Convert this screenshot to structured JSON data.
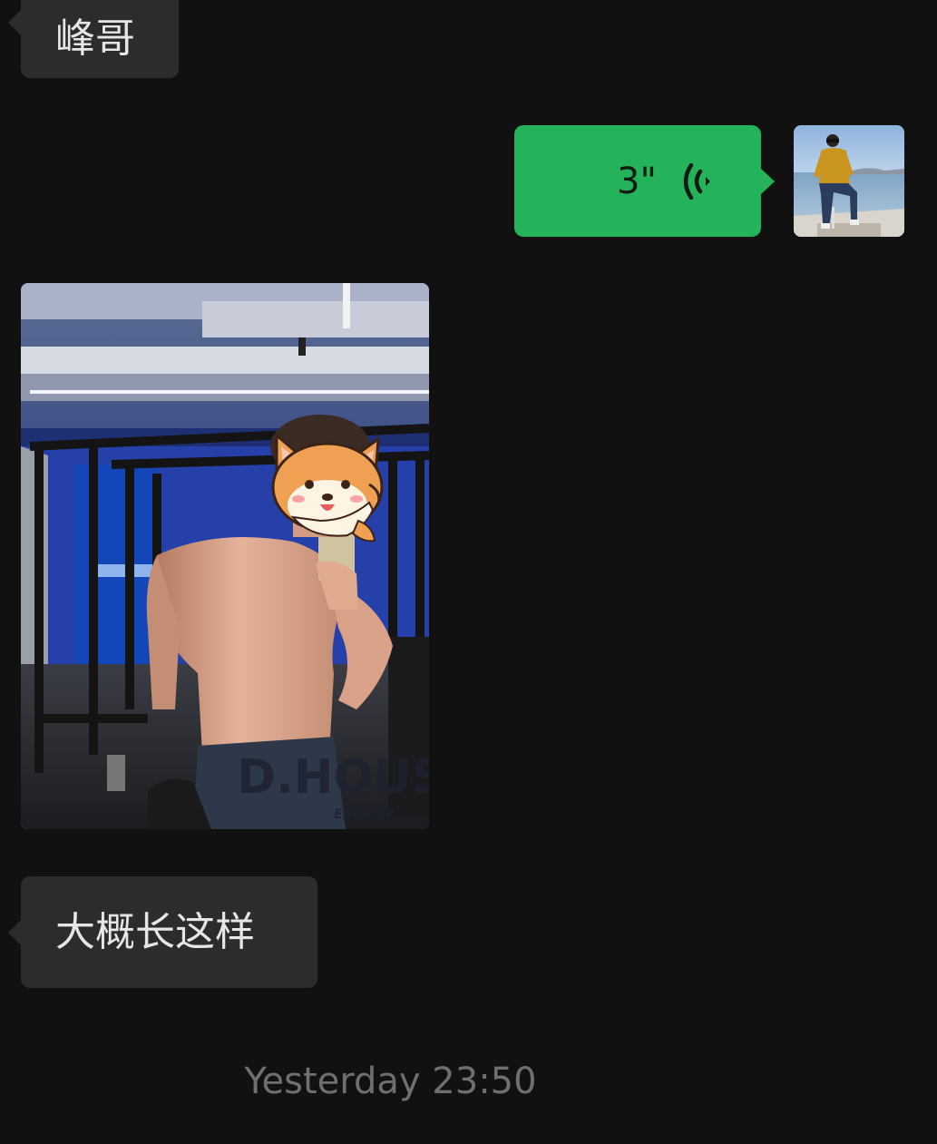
{
  "chat": {
    "messages": [
      {
        "direction": "incoming",
        "type": "text",
        "text": "峰哥"
      },
      {
        "direction": "outgoing",
        "type": "voice",
        "duration": "3\""
      },
      {
        "direction": "incoming",
        "type": "image"
      },
      {
        "direction": "incoming",
        "type": "text",
        "text": "大概长这样"
      }
    ],
    "timestamp": "Yesterday 23:50"
  },
  "photo": {
    "watermark_text": "D.HOUS",
    "watermark_subtext": "ERED BY"
  },
  "colors": {
    "background": "#111111",
    "incoming_bubble": "#2c2c2c",
    "outgoing_bubble": "#24b35b",
    "timestamp_text": "#6f6f6f"
  },
  "icons": {
    "voice": "voice-wave-icon",
    "sticker": "corgi-sticker-icon"
  }
}
